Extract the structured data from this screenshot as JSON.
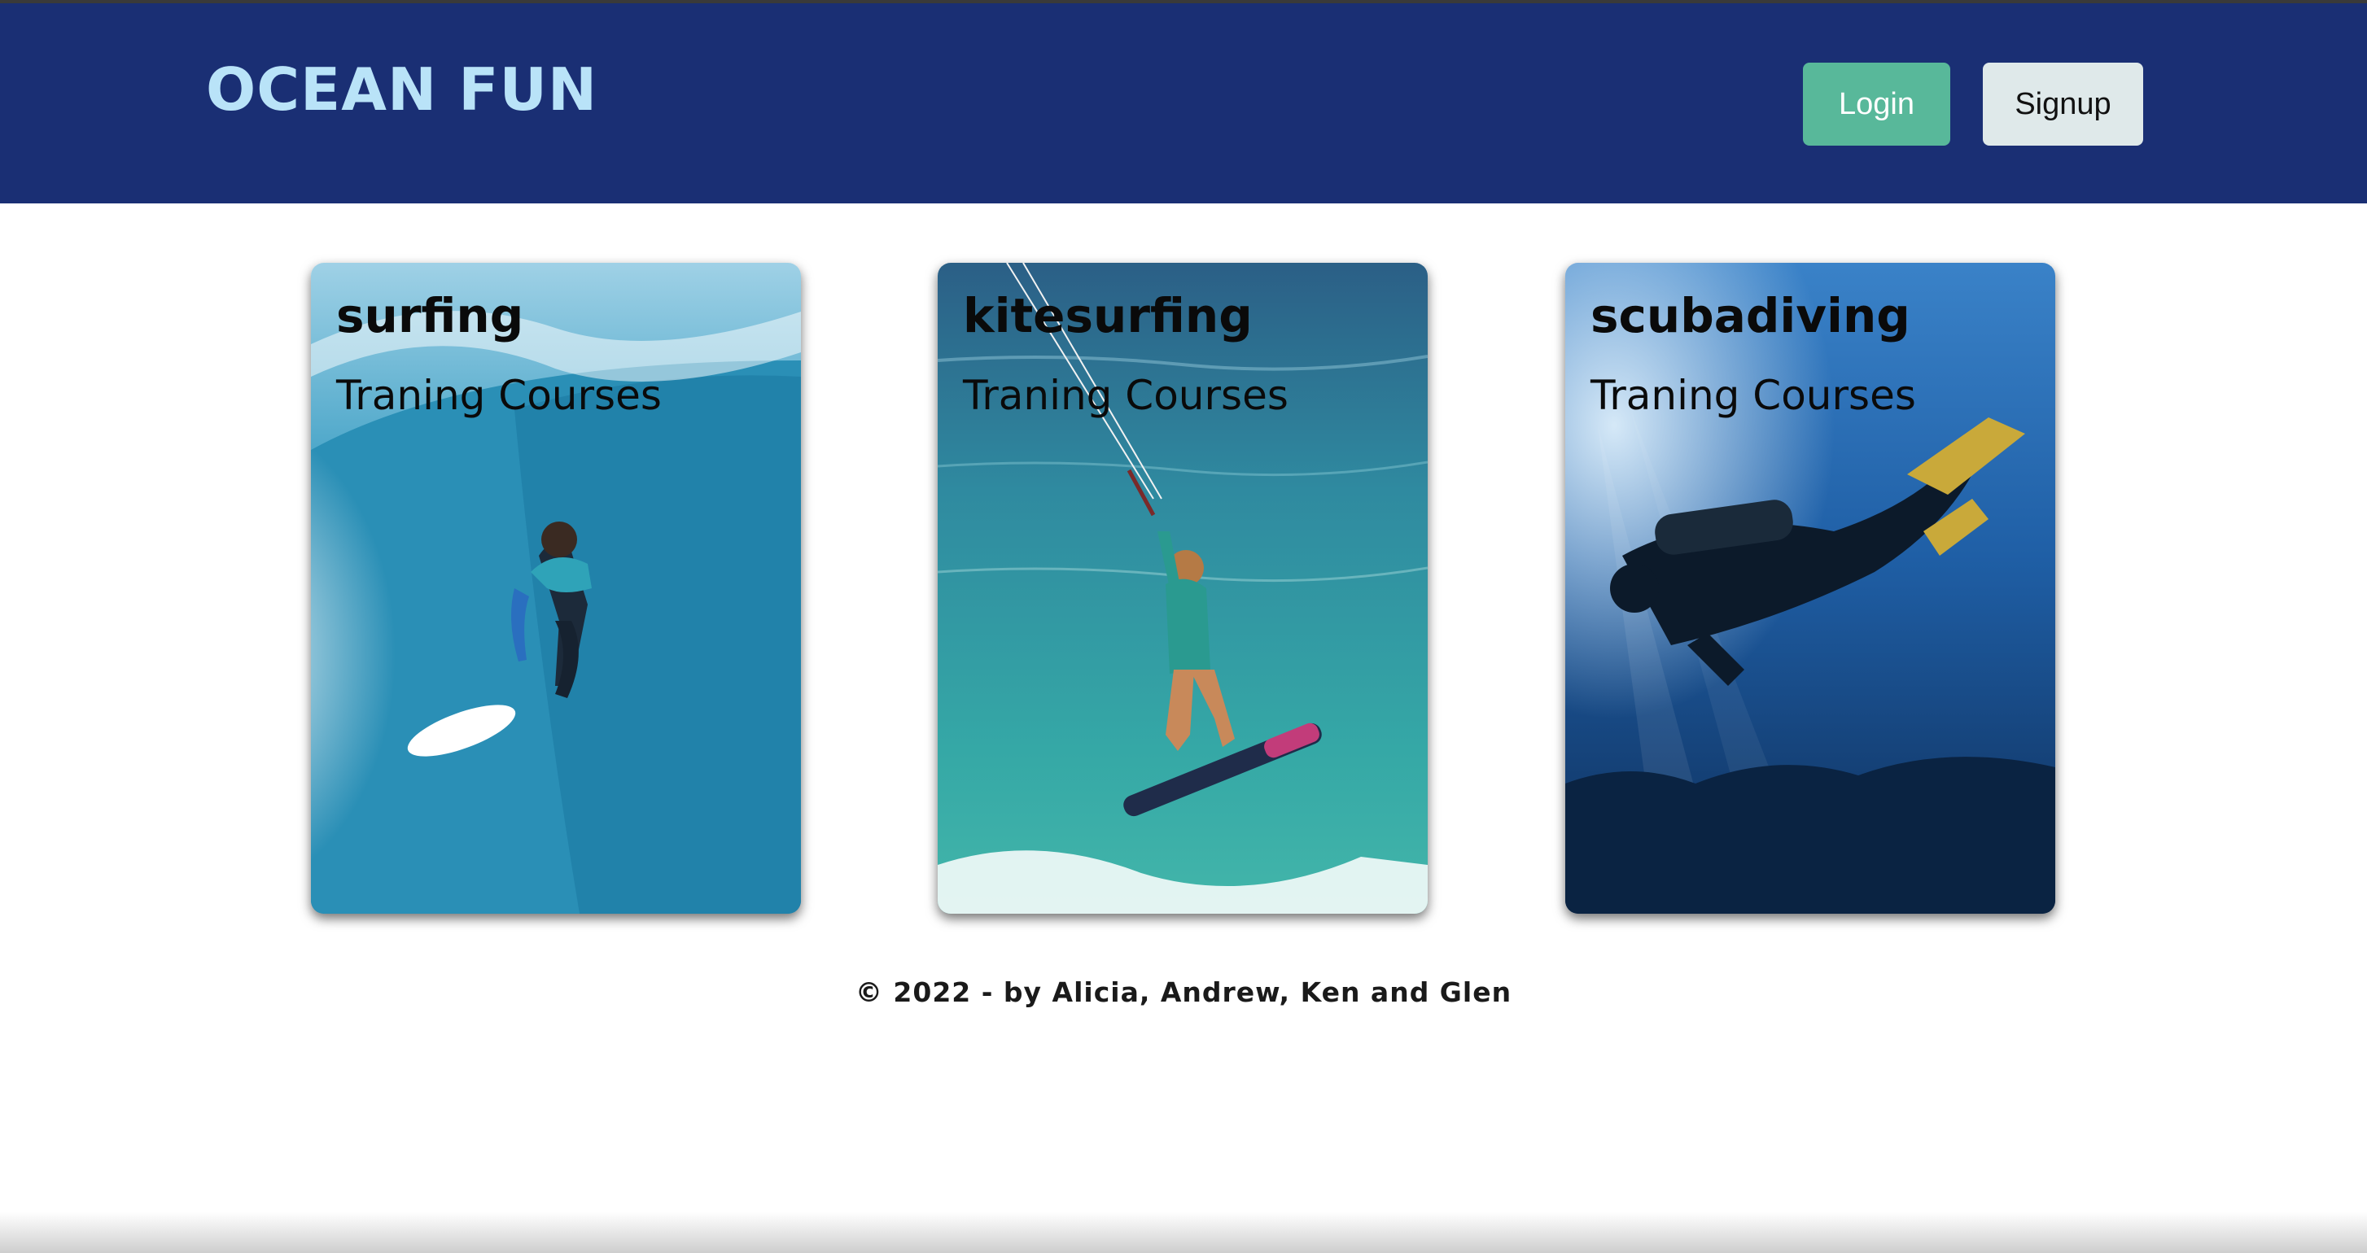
{
  "header": {
    "brand": "OCEAN FUN",
    "login_label": "Login",
    "signup_label": "Signup"
  },
  "cards": [
    {
      "title": "surfing",
      "subtitle": "Traning Courses",
      "image": "surfer-on-wave"
    },
    {
      "title": "kitesurfing",
      "subtitle": "Traning Courses",
      "image": "kitesurfer-jumping"
    },
    {
      "title": "scubadiving",
      "subtitle": "Traning Courses",
      "image": "scuba-diver-underwater"
    }
  ],
  "footer": {
    "text": "© 2022 - by Alicia, Andrew, Ken and Glen"
  },
  "colors": {
    "navbar": "#1a2f74",
    "brand": "#b9e3f8",
    "login_button": "#58b89a",
    "signup_button": "#dfe9ea"
  }
}
